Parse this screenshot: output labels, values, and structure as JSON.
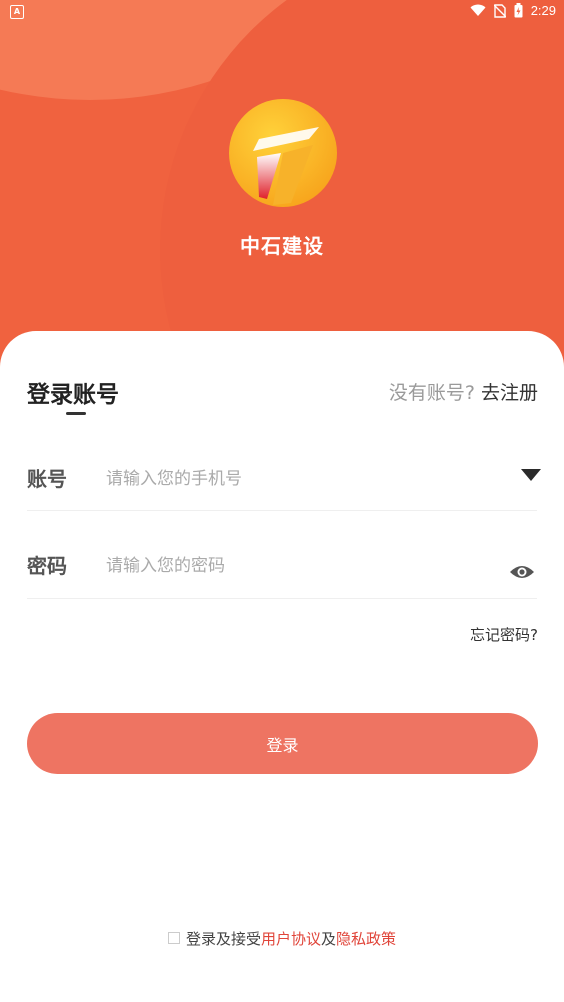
{
  "status_bar": {
    "time": "2:29",
    "left_icon_glyph": "A",
    "icons": [
      "wifi-icon",
      "no-sim-icon",
      "battery-charging-icon"
    ]
  },
  "app": {
    "name": "中石建设",
    "colors": {
      "primary": "#f0623f",
      "button": "#ee7462",
      "link_red": "#e0453a"
    }
  },
  "login": {
    "title": "登录账号",
    "register_prompt": "没有账号?",
    "register_link": "去注册",
    "account_label": "账号",
    "account_placeholder": "请输入您的手机号",
    "account_value": "",
    "password_label": "密码",
    "password_placeholder": "请输入您的密码",
    "password_value": "",
    "forgot_password": "忘记密码?",
    "submit_label": "登录"
  },
  "agreement": {
    "prefix": "登录及接受",
    "user_agreement": "用户协议",
    "conjunction": "及",
    "privacy_policy": "隐私政策",
    "checked": false
  }
}
